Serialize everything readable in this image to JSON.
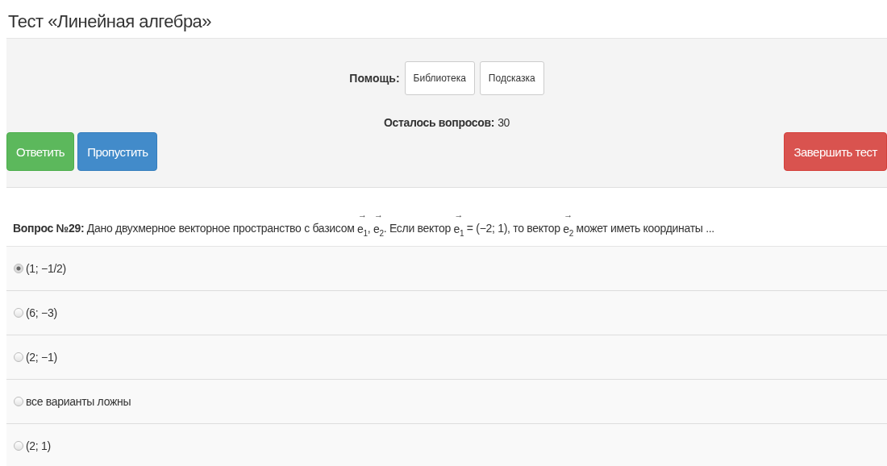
{
  "title": "Тест «Линейная алгебра»",
  "help": {
    "label": "Помощь:",
    "buttons": [
      "Библиотека",
      "Подсказка"
    ]
  },
  "remaining": {
    "label": "Осталось вопросов:",
    "value": "30"
  },
  "actions": [
    {
      "label": "Ответить",
      "kind": "success"
    },
    {
      "label": "Пропустить",
      "kind": "primary"
    },
    {
      "label": "Завершить тест",
      "kind": "danger"
    }
  ],
  "question": {
    "label": "Вопрос №29:",
    "segments": [
      {
        "kind": "text",
        "text": "Дано двухмерное векторное пространство с базисом "
      },
      {
        "kind": "vector",
        "arrow": "→",
        "base": "e",
        "index": "1"
      },
      {
        "kind": "text",
        "text": ", "
      },
      {
        "kind": "vector",
        "arrow": "→",
        "base": "e",
        "index": "2"
      },
      {
        "kind": "text",
        "text": ". Если вектор "
      },
      {
        "kind": "vector",
        "arrow": "→",
        "base": "e",
        "index": "1"
      },
      {
        "kind": "text",
        "text": " = (−2; 1), то вектор "
      },
      {
        "kind": "vector",
        "arrow": "→",
        "base": "e",
        "index": "2"
      },
      {
        "kind": "text",
        "text": " может иметь координаты ..."
      }
    ]
  },
  "answers": [
    {
      "label": "(1; −1/2)",
      "selected": true
    },
    {
      "label": "(6; −3)",
      "selected": false
    },
    {
      "label": "(2; −1)",
      "selected": false
    },
    {
      "label": "все варианты ложны",
      "selected": false
    },
    {
      "label": "(2; 1)",
      "selected": false
    }
  ]
}
